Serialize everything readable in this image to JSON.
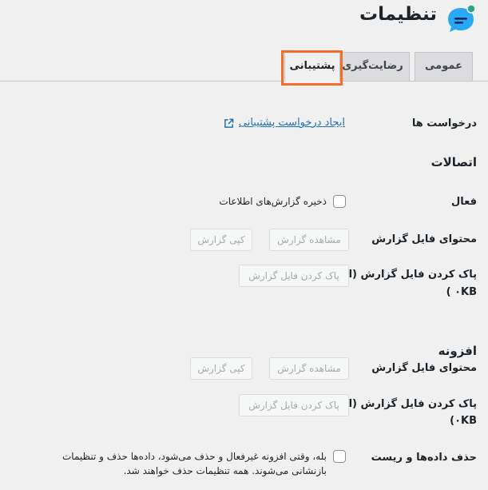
{
  "header": {
    "title": "تنظیمات"
  },
  "tabs": [
    {
      "label": "عمومی",
      "active": false
    },
    {
      "label": "رضایت‌گیری",
      "active": false
    },
    {
      "label": "پشتیبانی",
      "active": true
    }
  ],
  "requests": {
    "label": "درخواست ها",
    "link_text": "ایجاد درخواست پشتیبانی"
  },
  "connections": {
    "title": "اتصالات",
    "active_label": "فعال",
    "save_reports_label": "ذخیره گزارش‌های اطلاعات",
    "log_content_label": "محتوای فایل گزارش",
    "view_report": "مشاهده گزارش",
    "copy_report": "کپی گزارش",
    "clear_label_line1": "پاک کردن فایل گزارش (اندازه",
    "clear_label_line2": "۰KB )",
    "clear_button": "پاک کردن فایل گزارش"
  },
  "addon": {
    "title": "افزونه",
    "log_content_label": "محتوای فایل گزارش",
    "view_report": "مشاهده گزارش",
    "copy_report": "کپی گزارش",
    "clear_label_line1": "پاک کردن فایل گزارش (اندازه",
    "clear_label_line2": "۰KB)",
    "clear_button": "پاک کردن فایل گزارش",
    "delete_label": "حذف داده‌ها و ریست",
    "delete_text_line1": "بله، وقتی افزونه غیرفعال و حذف می‌شود، داده‌ها حذف و تنظیمات",
    "delete_text_line2": "بازنشانی می‌شوند. همه تنظیمات حذف خواهند شد."
  },
  "colors": {
    "accent": "#2271b1",
    "highlight": "#f56e28",
    "logo_bubble": "#2aa7f5",
    "logo_dot": "#2ca58d"
  }
}
